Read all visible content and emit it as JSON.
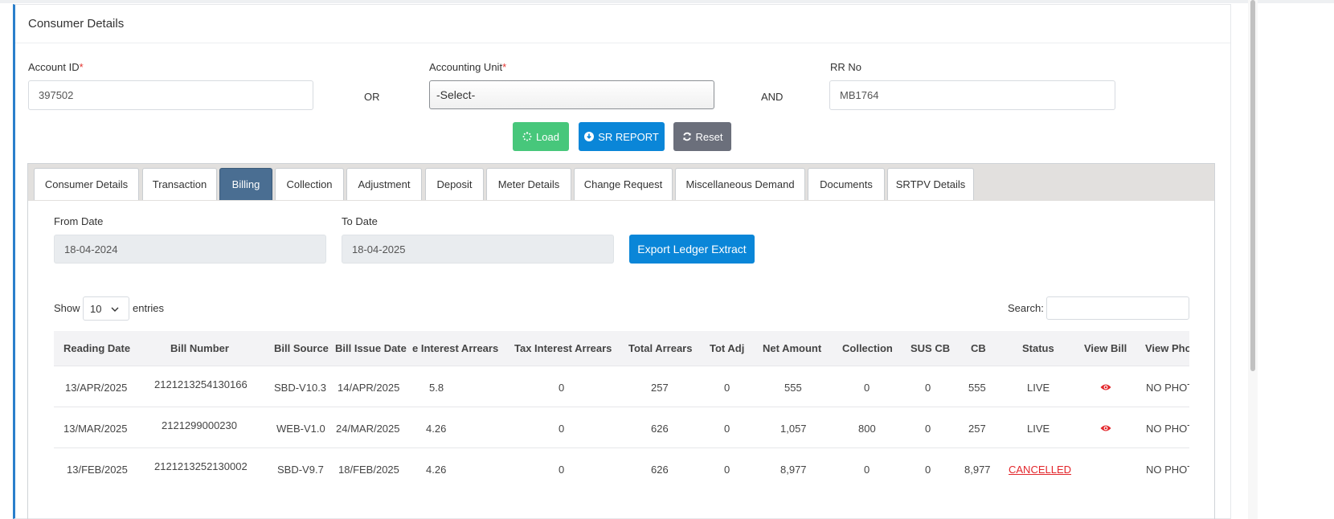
{
  "card": {
    "title": "Consumer Details"
  },
  "form": {
    "account_id_label": "Account ID",
    "account_id_value": "397502",
    "or_text": "OR",
    "accounting_unit_label": "Accounting Unit",
    "accounting_unit_value": "-Select-",
    "and_text": "AND",
    "rr_no_label": "RR No",
    "rr_no_value": "MB1764",
    "required_mark": "*"
  },
  "buttons": {
    "load": "Load",
    "sr_report": "SR REPORT",
    "reset": "Reset"
  },
  "tabs": [
    {
      "label": "Consumer Details"
    },
    {
      "label": "Transaction"
    },
    {
      "label": "Billing",
      "active": true
    },
    {
      "label": "Collection"
    },
    {
      "label": "Adjustment"
    },
    {
      "label": "Deposit"
    },
    {
      "label": "Meter Details"
    },
    {
      "label": "Change Request"
    },
    {
      "label": "Miscellaneous Demand"
    },
    {
      "label": "Documents"
    },
    {
      "label": "SRTPV Details"
    }
  ],
  "billing": {
    "from_date_label": "From Date",
    "from_date_value": "18-04-2024",
    "to_date_label": "To Date",
    "to_date_value": "18-04-2025",
    "export_button": "Export Ledger Extract",
    "show_label": "Show",
    "entries_value": "10",
    "entries_label": "entries",
    "search_label": "Search:"
  },
  "table": {
    "columns": [
      "Reading Date",
      "Bill Number",
      "Bill Source",
      "Bill Issue Date",
      "e Interest Arrears",
      "Tax Interest Arrears",
      "Total Arrears",
      "Tot Adj",
      "Net Amount",
      "Collection",
      "SUS CB",
      "CB",
      "Status",
      "View Bill",
      "View Pho"
    ],
    "rows": [
      {
        "reading_date": "13/APR/2025",
        "bill_number": "2121213254130166",
        "bill_source": "SBD-V10.3",
        "bill_issue_date": "14/APR/2025",
        "interest_arrears": "5.8",
        "tax_interest_arrears": "0",
        "total_arrears": "257",
        "tot_adj": "0",
        "net_amount": "555",
        "collection": "0",
        "sus_cb": "0",
        "cb": "555",
        "status": "LIVE",
        "view_bill": "eye-icon",
        "view_photo": "NO PHOT"
      },
      {
        "reading_date": "13/MAR/2025",
        "bill_number": "2121299000230",
        "bill_source": "WEB-V1.0",
        "bill_issue_date": "24/MAR/2025",
        "interest_arrears": "4.26",
        "tax_interest_arrears": "0",
        "total_arrears": "626",
        "tot_adj": "0",
        "net_amount": "1,057",
        "collection": "800",
        "sus_cb": "0",
        "cb": "257",
        "status": "LIVE",
        "view_bill": "eye-icon",
        "view_photo": "NO PHOT"
      },
      {
        "reading_date": "13/FEB/2025",
        "bill_number": "2121213252130002",
        "bill_source": "SBD-V9.7",
        "bill_issue_date": "18/FEB/2025",
        "interest_arrears": "4.26",
        "tax_interest_arrears": "0",
        "total_arrears": "626",
        "tot_adj": "0",
        "net_amount": "8,977",
        "collection": "0",
        "sus_cb": "0",
        "cb": "8,977",
        "status": "CANCELLED",
        "view_bill": "",
        "view_photo": "NO PHOT"
      }
    ]
  },
  "colors": {
    "accent": "#2a7fcb",
    "active_tab": "#4a6e92",
    "load_button": "#47c77b",
    "primary_button": "#0a86d8",
    "reset_button": "#6b6f7b",
    "danger": "#e3262b"
  }
}
